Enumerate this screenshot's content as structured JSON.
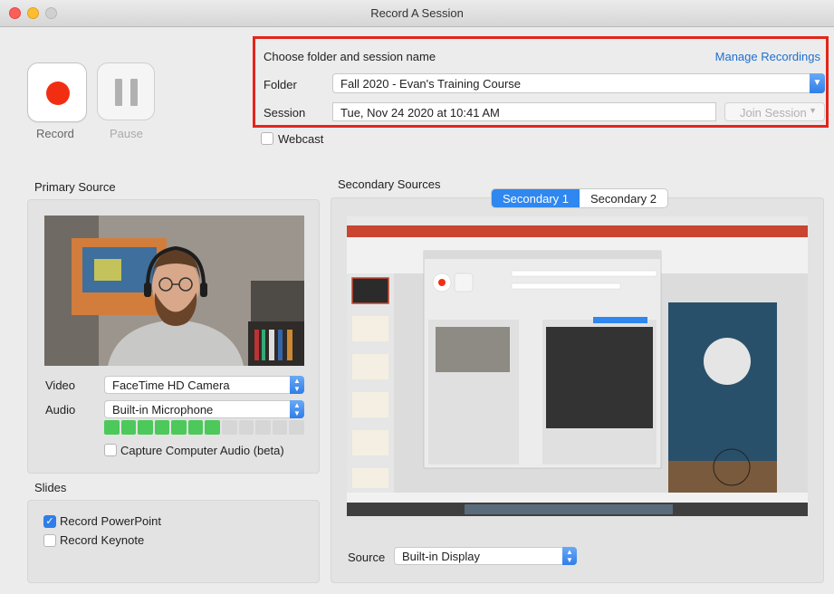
{
  "window": {
    "title": "Record A Session"
  },
  "controls": {
    "record_label": "Record",
    "pause_label": "Pause"
  },
  "session": {
    "heading": "Choose folder and session name",
    "manage_link": "Manage Recordings",
    "folder_label": "Folder",
    "folder_value": "Fall 2020 - Evan's Training Course",
    "session_label": "Session",
    "session_value": "Tue, Nov 24 2020 at 10:41 AM",
    "join_label": "Join Session"
  },
  "webcast": {
    "label": "Webcast",
    "checked": false
  },
  "primary": {
    "title": "Primary Source",
    "video_label": "Video",
    "video_value": "FaceTime HD Camera",
    "audio_label": "Audio",
    "audio_value": "Built-in Microphone",
    "audio_level": 0.6,
    "capture_audio_label": "Capture Computer Audio (beta)",
    "capture_audio_checked": false
  },
  "slides": {
    "title": "Slides",
    "powerpoint_label": "Record PowerPoint",
    "powerpoint_checked": true,
    "keynote_label": "Record Keynote",
    "keynote_checked": false
  },
  "secondary": {
    "title": "Secondary Sources",
    "tabs": [
      "Secondary 1",
      "Secondary 2"
    ],
    "active_tab": 0,
    "source_label": "Source",
    "source_value": "Built-in Display"
  },
  "colors": {
    "accent": "#2f87ef",
    "record_red": "#f22e12",
    "highlight_box": "#e3261a",
    "meter_on": "#4cc95a",
    "meter_off": "#d6d6d6",
    "link": "#1f6fd1"
  }
}
